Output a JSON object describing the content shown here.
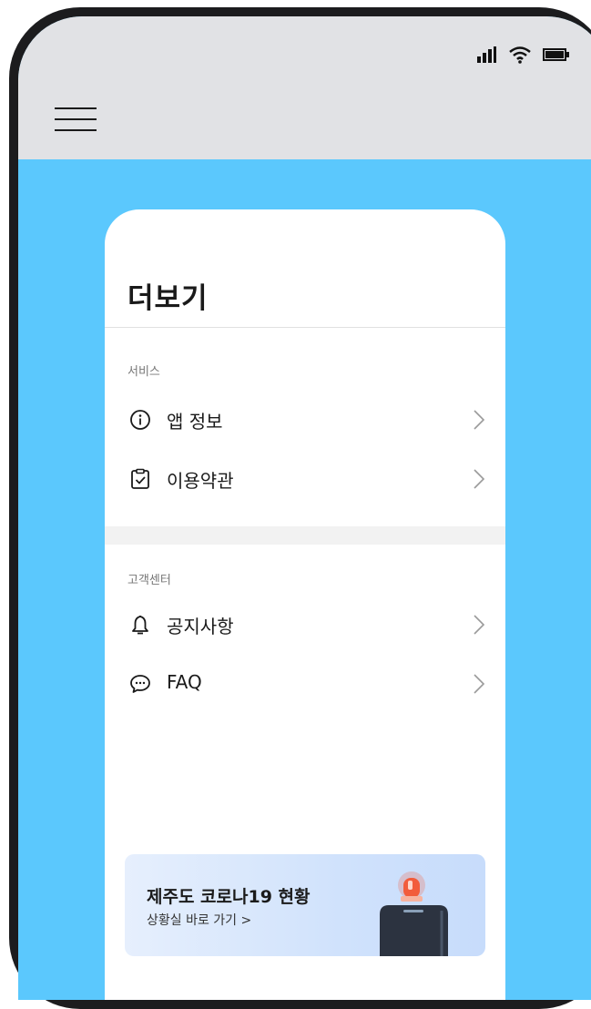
{
  "page": {
    "title": "더보기"
  },
  "sections": [
    {
      "label": "서비스",
      "items": [
        {
          "label": "앱 정보",
          "icon": "info-icon"
        },
        {
          "label": "이용약관",
          "icon": "clipboard-check-icon"
        }
      ]
    },
    {
      "label": "고객센터",
      "items": [
        {
          "label": "공지사항",
          "icon": "bell-icon"
        },
        {
          "label": "FAQ",
          "icon": "chat-bubble-icon"
        }
      ]
    }
  ],
  "banner": {
    "title": "제주도 코로나19 현황",
    "subtitle": "상황실 바로 가기 >"
  },
  "colors": {
    "background": "#5bc8fd",
    "topbar": "#e1e2e5",
    "card": "#ffffff",
    "siren": "#f25c3b"
  }
}
